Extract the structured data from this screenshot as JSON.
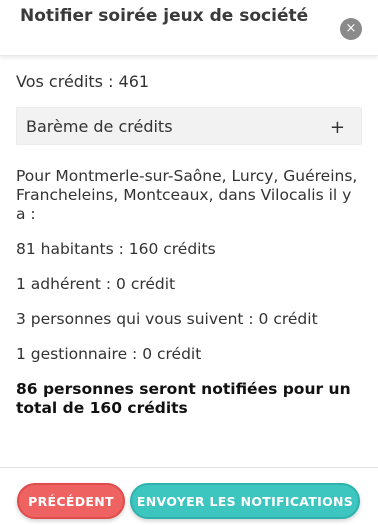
{
  "dialog": {
    "title": "Notifier soirée jeux de société",
    "close_symbol": "×"
  },
  "credits": {
    "text": "Vos crédits : 461"
  },
  "accordion": {
    "label": "Barème de crédits",
    "toggle_symbol": "+"
  },
  "audience": {
    "intro": "Pour Montmerle-sur-Saône, Lurcy, Guéreins, Francheleins, Montceaux, dans Vilocalis il y a :",
    "rows": [
      "81 habitants : 160 crédits",
      "1 adhérent : 0 crédit",
      "3 personnes qui vous suivent : 0 crédit",
      "1 gestionnaire : 0 crédit"
    ],
    "summary": "86 personnes seront notifiées pour un total de 160 crédits"
  },
  "footer": {
    "prev_label": "PRÉCÉDENT",
    "send_label": "ENVOYER LES NOTIFICATIONS"
  },
  "colors": {
    "prev_button": "#ee6262",
    "send_button": "#3dc6c0",
    "close_button": "#8a8a8a"
  },
  "icons": {
    "close": "close-icon",
    "expand": "plus-icon"
  }
}
